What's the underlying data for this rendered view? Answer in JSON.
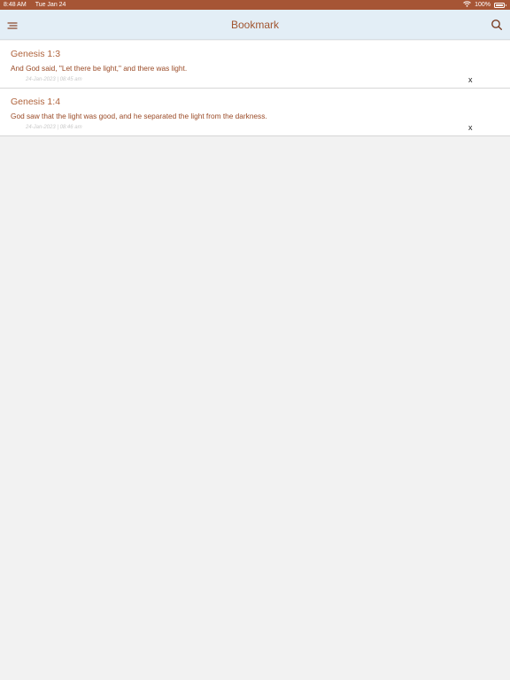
{
  "status_bar": {
    "time": "8:48 AM",
    "date": "Tue Jan 24",
    "battery_text": "100%",
    "icons": [
      "wifi-icon",
      "battery-icon"
    ]
  },
  "nav": {
    "title": "Bookmark",
    "left_icon": "menu-icon",
    "right_icon": "search-icon"
  },
  "bookmarks": [
    {
      "reference": "Genesis 1:3",
      "text": "And God said, \"Let there be light,\" and there was light.",
      "date": "24-Jan-2023 | 08:45 am",
      "delete_label": "x"
    },
    {
      "reference": "Genesis 1:4",
      "text": "God saw that the light was good, and he separated the light from the darkness.",
      "date": "24-Jan-2023 | 08:46 am",
      "delete_label": "x"
    }
  ],
  "colors": {
    "status_bar_bg": "#a65535",
    "nav_bg": "#e3eef6",
    "accent": "#a0542f",
    "page_bg": "#f2f2f2"
  }
}
